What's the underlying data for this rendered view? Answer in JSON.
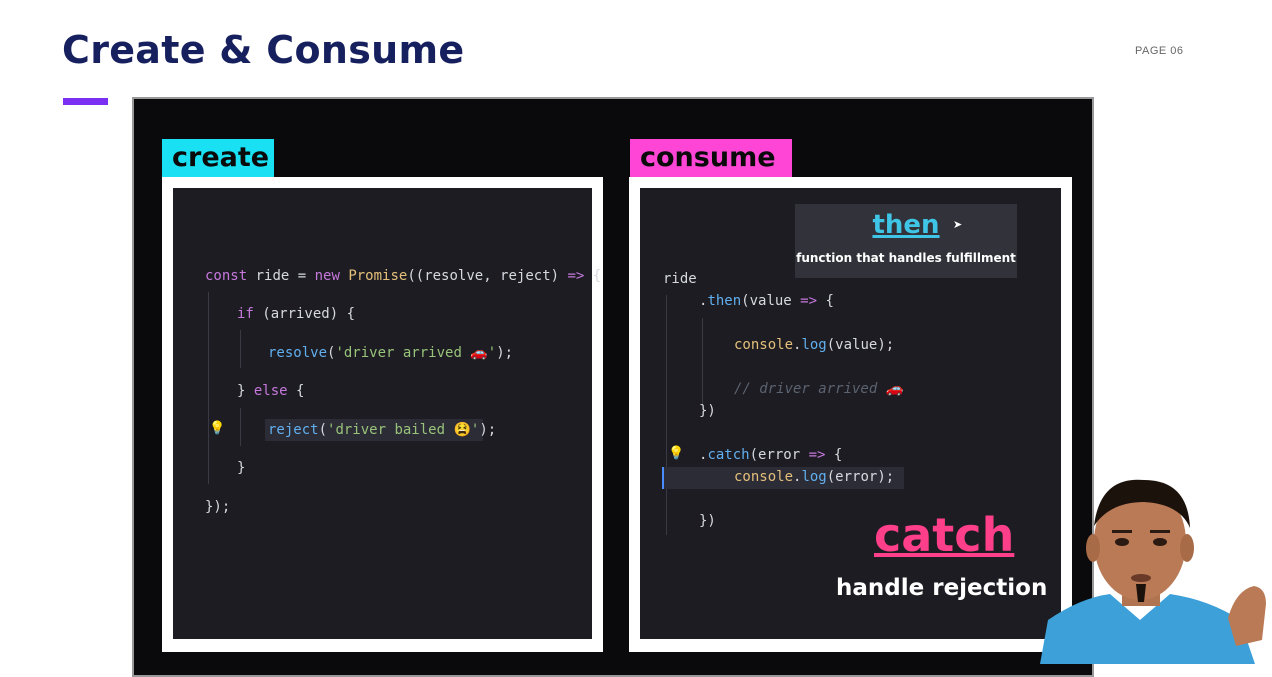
{
  "slide": {
    "title": "Create & Consume",
    "page_label": "PAGE 06"
  },
  "create_panel": {
    "tag": "create",
    "code": {
      "l1_a": "const",
      "l1_b": " ride = ",
      "l1_c": "new",
      "l1_d": "Promise",
      "l1_e": "((resolve, reject) ",
      "l1_f": "=>",
      "l1_g": " {",
      "l2_a": "if",
      "l2_b": " (arrived) {",
      "l3_a": "resolve",
      "l3_b": "(",
      "l3_c": "'driver arrived 🚗'",
      "l3_d": ");",
      "l4_a": "} ",
      "l4_b": "else",
      "l4_c": " {",
      "l5_a": "reject",
      "l5_b": "(",
      "l5_c": "'driver bailed 😫'",
      "l5_d": ");",
      "l6": "}",
      "l7": "});"
    }
  },
  "consume_panel": {
    "tag": "consume",
    "code": {
      "l1": "ride",
      "l2_a": ".",
      "l2_b": "then",
      "l2_c": "(value ",
      "l2_d": "=>",
      "l2_e": " {",
      "l3_a": "console",
      "l3_b": ".",
      "l3_c": "log",
      "l3_d": "(value);",
      "l4": "// driver arrived 🚗",
      "l5": "})",
      "l6_a": ".",
      "l6_b": "catch",
      "l6_c": "(error ",
      "l6_d": "=>",
      "l6_e": " {",
      "l7_a": "console",
      "l7_b": ".",
      "l7_c": "log",
      "l7_d": "(error);",
      "l8": "})"
    },
    "then_tip": {
      "title": "then",
      "description": "function that handles fulfillment"
    },
    "catch_tip": {
      "title": "catch",
      "description": "handle rejection"
    }
  },
  "icons": {
    "bulb": "💡"
  }
}
